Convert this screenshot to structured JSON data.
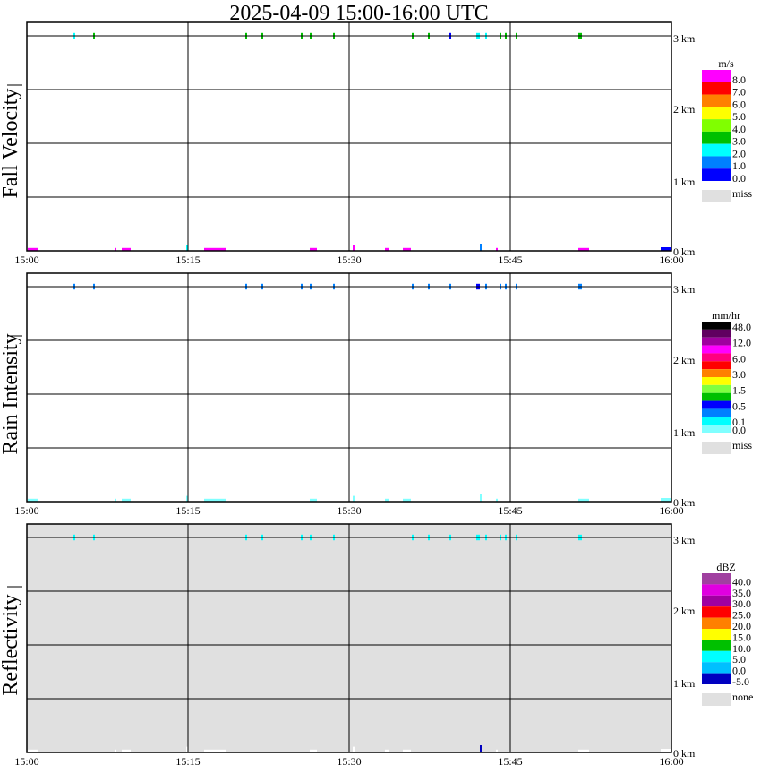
{
  "title": "2025-04-09   15:00-16:00 UTC",
  "chart_data": {
    "type": "heatmap",
    "x_range": [
      "15:00:00",
      "16:00:00"
    ],
    "x_ticks": [
      "15:00",
      "15:15",
      "15:30",
      "15:45",
      "16:00"
    ],
    "y_range_km": [
      0,
      3
    ],
    "y_ticks": [
      "3 km",
      "2 km",
      "1 km",
      "0 km"
    ],
    "grid": true,
    "legend_placement": "right",
    "panels": [
      {
        "ylabel": "Fall Velocity",
        "field": "fall_velocity",
        "units": "m/s",
        "background": "#ffffff",
        "legend_labels": [
          "8.0",
          "7.0",
          "6.0",
          "5.0",
          "4.0",
          "3.0",
          "2.0",
          "1.0",
          "0.0"
        ],
        "legend_colors_top_down": [
          "#ff00ff",
          "#ff0000",
          "#ff8000",
          "#ffff00",
          "#80ff00",
          "#00c000",
          "#00ffff",
          "#0080ff",
          "#0000ff"
        ],
        "bin_edges": [
          0,
          1,
          2,
          3,
          4,
          5,
          6,
          7,
          8
        ],
        "missing_label": "miss",
        "missing_color": "#e0e0e0"
      },
      {
        "ylabel": "Rain Intensity",
        "field": "rain",
        "units": "mm/hr",
        "background": "#ffffff",
        "legend_labels": [
          "48.0",
          "12.0",
          "6.0",
          "3.0",
          "1.5",
          "0.5",
          "0.1",
          "0.0"
        ],
        "legend_colors_top_down": [
          "#000000",
          "#600060",
          "#a000a0",
          "#ff00ff",
          "#ff0080",
          "#ff0000",
          "#ff8000",
          "#ffff00",
          "#80ff40",
          "#00c000",
          "#0000ff",
          "#0080ff",
          "#00ffff",
          "#80ffff"
        ],
        "bin_edges": [
          0,
          0.05,
          0.1,
          0.25,
          0.5,
          1,
          1.5,
          2,
          3,
          4,
          6,
          8,
          12,
          24
        ],
        "missing_label": "miss",
        "missing_color": "#e0e0e0"
      },
      {
        "ylabel": "Reflectivity",
        "field": "dbz",
        "units": "dBZ",
        "background": "#e0e0e0",
        "legend_labels": [
          "40.0",
          "35.0",
          "30.0",
          "25.0",
          "20.0",
          "15.0",
          "10.0",
          "5.0",
          "0.0",
          "-5.0"
        ],
        "legend_colors_top_down": [
          "#a040a0",
          "#e000e0",
          "#a000a0",
          "#ff0000",
          "#ff8000",
          "#ffff00",
          "#00c000",
          "#00ffff",
          "#00c0ff",
          "#0000c0"
        ],
        "bin_edges": [
          -5,
          0,
          5,
          10,
          15,
          20,
          25,
          30,
          35,
          40
        ],
        "below_color": "#ffffff",
        "missing_label": "none",
        "missing_color": "#e0e0e0"
      }
    ],
    "echoes": [
      {
        "start": "15:04:20",
        "end": "15:04:30",
        "base_km": 2.96,
        "top_km": 3.04,
        "fall_velocity": 2.5,
        "rain": 0.2,
        "dbz": 7
      },
      {
        "start": "15:06:10",
        "end": "15:06:20",
        "base_km": 2.96,
        "top_km": 3.04,
        "fall_velocity": 3.5,
        "rain": 0.2,
        "dbz": 7
      },
      {
        "start": "15:20:20",
        "end": "15:20:30",
        "base_km": 2.96,
        "top_km": 3.04,
        "fall_velocity": 3.5,
        "rain": 0.2,
        "dbz": 7
      },
      {
        "start": "15:21:50",
        "end": "15:22:00",
        "base_km": 2.96,
        "top_km": 3.04,
        "fall_velocity": 3.5,
        "rain": 0.2,
        "dbz": 7
      },
      {
        "start": "15:25:30",
        "end": "15:25:40",
        "base_km": 2.96,
        "top_km": 3.04,
        "fall_velocity": 3.5,
        "rain": 0.2,
        "dbz": 7
      },
      {
        "start": "15:26:20",
        "end": "15:26:30",
        "base_km": 2.96,
        "top_km": 3.04,
        "fall_velocity": 3.5,
        "rain": 0.2,
        "dbz": 7
      },
      {
        "start": "15:28:30",
        "end": "15:28:40",
        "base_km": 2.96,
        "top_km": 3.04,
        "fall_velocity": 3.5,
        "rain": 0.2,
        "dbz": 7
      },
      {
        "start": "15:35:50",
        "end": "15:36:00",
        "base_km": 2.96,
        "top_km": 3.04,
        "fall_velocity": 3.5,
        "rain": 0.2,
        "dbz": 7
      },
      {
        "start": "15:37:20",
        "end": "15:37:30",
        "base_km": 2.96,
        "top_km": 3.04,
        "fall_velocity": 3.5,
        "rain": 0.2,
        "dbz": 7
      },
      {
        "start": "15:39:20",
        "end": "15:39:30",
        "base_km": 2.96,
        "top_km": 3.04,
        "fall_velocity": 0.5,
        "rain": 0.2,
        "dbz": 7
      },
      {
        "start": "15:41:50",
        "end": "15:42:10",
        "base_km": 2.96,
        "top_km": 3.04,
        "fall_velocity": 2.5,
        "rain": 0.3,
        "dbz": 7
      },
      {
        "start": "15:42:40",
        "end": "15:42:50",
        "base_km": 2.96,
        "top_km": 3.04,
        "fall_velocity": 2.5,
        "rain": 0.2,
        "dbz": 7
      },
      {
        "start": "15:44:00",
        "end": "15:44:10",
        "base_km": 2.96,
        "top_km": 3.04,
        "fall_velocity": 3.5,
        "rain": 0.2,
        "dbz": 7
      },
      {
        "start": "15:44:30",
        "end": "15:44:40",
        "base_km": 2.96,
        "top_km": 3.04,
        "fall_velocity": 3.5,
        "rain": 0.2,
        "dbz": 7
      },
      {
        "start": "15:45:30",
        "end": "15:45:40",
        "base_km": 2.96,
        "top_km": 3.04,
        "fall_velocity": 3.5,
        "rain": 0.2,
        "dbz": 7
      },
      {
        "start": "15:51:20",
        "end": "15:51:40",
        "base_km": 2.96,
        "top_km": 3.04,
        "fall_velocity": 3.5,
        "rain": 0.2,
        "dbz": 7
      },
      {
        "start": "15:00:05",
        "end": "15:01:00",
        "base_km": 0,
        "top_km": 0.04,
        "fall_velocity": 9,
        "rain": 0.02,
        "dbz": -10
      },
      {
        "start": "15:08:10",
        "end": "15:08:20",
        "base_km": 0,
        "top_km": 0.04,
        "fall_velocity": 9,
        "rain": 0.02,
        "dbz": -10
      },
      {
        "start": "15:08:50",
        "end": "15:09:40",
        "base_km": 0,
        "top_km": 0.04,
        "fall_velocity": 9,
        "rain": 0.02,
        "dbz": -10
      },
      {
        "start": "15:14:50",
        "end": "15:15:00",
        "base_km": 0,
        "top_km": 0.08,
        "fall_velocity": 2.5,
        "rain": 0.02,
        "dbz": -10
      },
      {
        "start": "15:16:30",
        "end": "15:18:30",
        "base_km": 0,
        "top_km": 0.04,
        "fall_velocity": 9,
        "rain": 0.02,
        "dbz": -10
      },
      {
        "start": "15:26:20",
        "end": "15:27:00",
        "base_km": 0,
        "top_km": 0.04,
        "fall_velocity": 9,
        "rain": 0.02,
        "dbz": -10
      },
      {
        "start": "15:30:20",
        "end": "15:30:30",
        "base_km": 0,
        "top_km": 0.08,
        "fall_velocity": 9,
        "rain": 0.02,
        "dbz": -10
      },
      {
        "start": "15:33:20",
        "end": "15:33:40",
        "base_km": 0,
        "top_km": 0.04,
        "fall_velocity": 9,
        "rain": 0.02,
        "dbz": -10
      },
      {
        "start": "15:35:00",
        "end": "15:35:45",
        "base_km": 0,
        "top_km": 0.04,
        "fall_velocity": 9,
        "rain": 0.02,
        "dbz": -10
      },
      {
        "start": "15:42:10",
        "end": "15:42:20",
        "base_km": 0,
        "top_km": 0.1,
        "fall_velocity": 1.5,
        "rain": 0.02,
        "dbz": -2
      },
      {
        "start": "15:43:40",
        "end": "15:43:50",
        "base_km": 0,
        "top_km": 0.04,
        "fall_velocity": 9,
        "rain": 0.02,
        "dbz": -10
      },
      {
        "start": "15:51:20",
        "end": "15:52:20",
        "base_km": 0,
        "top_km": 0.04,
        "fall_velocity": 9,
        "rain": 0.02,
        "dbz": -10
      },
      {
        "start": "15:59:00",
        "end": "16:00:00",
        "base_km": 0,
        "top_km": 0.05,
        "fall_velocity": 0.5,
        "rain": 0.02,
        "dbz": -10
      }
    ]
  }
}
